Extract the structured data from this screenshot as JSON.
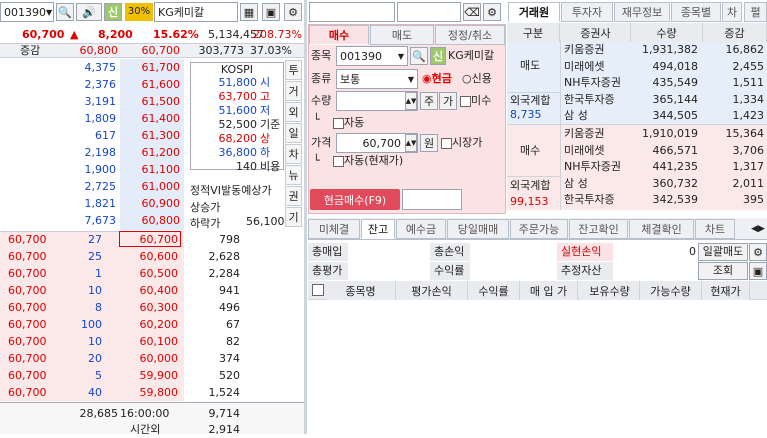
{
  "left": {
    "code": "001390",
    "flag": "신",
    "pct": "30%",
    "name": "KG케미칼",
    "price": "60,700",
    "up": "▲",
    "change": "8,200",
    "rate": "15.62%",
    "volume": "5,134,457",
    "vol_rate": "208.73%",
    "hdr_label": "증감",
    "hdr_price": "60,800",
    "hdr_price2": "60,700",
    "hdr_vol": "303,773",
    "hdr_pct": "37.03%",
    "ask_qty": [
      "4,375",
      "2,376",
      "3,191",
      "1,809",
      "617",
      "2,198",
      "1,900",
      "2,725",
      "1,821",
      "7,673"
    ],
    "ask_price": [
      "61,700",
      "61,600",
      "61,500",
      "61,400",
      "61,300",
      "61,200",
      "61,100",
      "61,000",
      "60,900",
      "60,800"
    ],
    "bid_price": [
      "60,700",
      "60,600",
      "60,500",
      "60,400",
      "60,300",
      "60,200",
      "60,100",
      "60,000",
      "59,900",
      "59,800"
    ],
    "bid_qty": [
      "798",
      "2,628",
      "2,284",
      "941",
      "496",
      "67",
      "82",
      "374",
      "520",
      "1,524"
    ],
    "trade_price": [
      "60,700",
      "60,700",
      "60,700",
      "60,700",
      "60,700",
      "60,700",
      "60,700",
      "60,700",
      "60,700",
      "60,700"
    ],
    "trade_qty": [
      "27",
      "25",
      "1",
      "10",
      "8",
      "100",
      "10",
      "20",
      "5",
      "40"
    ],
    "kospi_title": "KOSPI",
    "info_rows": [
      {
        "v": "51,800",
        "k": "시",
        "c": "blue"
      },
      {
        "v": "63,700",
        "k": "고",
        "c": "red"
      },
      {
        "v": "51,600",
        "k": "저",
        "c": "blue"
      },
      {
        "v": "52,500",
        "k": "기준",
        "c": "blk"
      },
      {
        "v": "68,200",
        "k": "상",
        "c": "red"
      },
      {
        "v": "36,800",
        "k": "하",
        "c": "blue"
      },
      {
        "v": "140",
        "k": "비용",
        "c": "blk"
      }
    ],
    "vi_label": "정적VI발동예상가",
    "vi_up": "상승가",
    "vi_down": "하락가",
    "vi_down_val": "56,100",
    "side_tabs": [
      "투",
      "거",
      "외",
      "일",
      "차",
      "뉴",
      "권",
      "기"
    ],
    "total_ask": "28,685",
    "time": "16:00:00",
    "total_bid": "9,714",
    "after_label": "시간외",
    "after_val": "2,914"
  },
  "order": {
    "tabs": [
      "매수",
      "매도",
      "정정/취소"
    ],
    "code_label": "종목",
    "code": "001390",
    "flag": "신",
    "name": "KG케미칼",
    "type_label": "종류",
    "type_value": "보통",
    "cash_label": "현금",
    "credit_label": "신용",
    "qty_label": "수량",
    "qty_btn1": "주",
    "qty_btn2": "가",
    "nomisu": "미수",
    "auto1": "자동",
    "price_label": "가격",
    "price": "60,700",
    "won": "원",
    "market": "시장가",
    "auto2": "자동(현재가)",
    "submit": "현금매수(F9)"
  },
  "broker": {
    "tabs": [
      "거래원",
      "투자자",
      "재무정보",
      "종목별",
      "차",
      "펼"
    ],
    "headers": [
      "구분",
      "증권사",
      "수량",
      "증감"
    ],
    "sell_label": "매도",
    "sell": [
      {
        "n": "키움증권",
        "q": "1,931,382",
        "d": "16,862"
      },
      {
        "n": "미래에셋",
        "q": "494,018",
        "d": "2,455"
      },
      {
        "n": "NH투자증권",
        "q": "435,549",
        "d": "1,511"
      },
      {
        "n": "한국투자증",
        "q": "365,144",
        "d": "1,334"
      },
      {
        "n": "삼 성",
        "q": "344,505",
        "d": "1,423"
      }
    ],
    "foreign_label": "외국계합",
    "foreign_sell": "8,735",
    "buy_label": "매수",
    "buy": [
      {
        "n": "키움증권",
        "q": "1,910,019",
        "d": "15,364"
      },
      {
        "n": "미래에셋",
        "q": "466,571",
        "d": "3,706"
      },
      {
        "n": "NH투자증권",
        "q": "441,235",
        "d": "1,317"
      },
      {
        "n": "삼 성",
        "q": "360,732",
        "d": "2,011"
      },
      {
        "n": "한국투자증",
        "q": "342,539",
        "d": "395"
      }
    ],
    "foreign_buy": "99,153"
  },
  "balance": {
    "tabs": [
      "미체결",
      "잔고",
      "예수금",
      "당일매매",
      "주문가능",
      "잔고확인",
      "체결확인",
      "차트"
    ],
    "r1": [
      "총매입",
      "총손익",
      "실현손익",
      "0",
      "일괄매도"
    ],
    "r2": [
      "총평가",
      "수익률",
      "추정자산",
      "조회"
    ],
    "cols": [
      "종목명",
      "평가손익",
      "수익률",
      "매 입 가",
      "보유수량",
      "가능수량",
      "현재가"
    ]
  }
}
